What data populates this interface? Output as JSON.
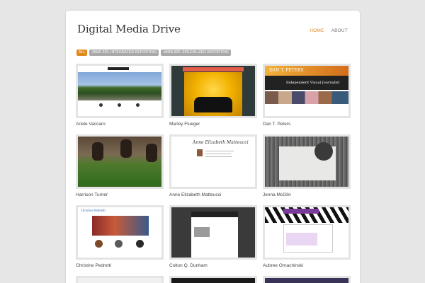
{
  "header": {
    "site_title": "Digital Media Drive",
    "nav": [
      {
        "label": "HOME",
        "active": true
      },
      {
        "label": "ABOUT",
        "active": false
      }
    ]
  },
  "filters": [
    {
      "label": "ALL",
      "active": true
    },
    {
      "label": "JAMS 320: INTEGRATED REPORTING",
      "active": false
    },
    {
      "label": "JAMS 602: SPECIALIZED REPORTING",
      "active": false
    }
  ],
  "portfolio": [
    {
      "name": "Ariele Vaccaro"
    },
    {
      "name": "Marley Flueger"
    },
    {
      "name": "Dan T. Peters"
    },
    {
      "name": "Harrison Turner"
    },
    {
      "name": "Anne Elizabeth Matteucci"
    },
    {
      "name": "Jenna McGlin"
    },
    {
      "name": "Christine Pedretti"
    },
    {
      "name": "Colton Q. Dunham"
    },
    {
      "name": "Aubree Ornachinski"
    }
  ],
  "thumb_text": {
    "peters_name": "DAN T. PETERS",
    "peters_tagline": "Independent Visual Journalist",
    "matteucci_sig": "Anne Elizabeth Matteucci",
    "pedretti_title": "Christine Pedretti"
  },
  "colors": {
    "accent": "#e08a1e",
    "chip": "#a9a9a9",
    "background": "#e6e6e6"
  }
}
